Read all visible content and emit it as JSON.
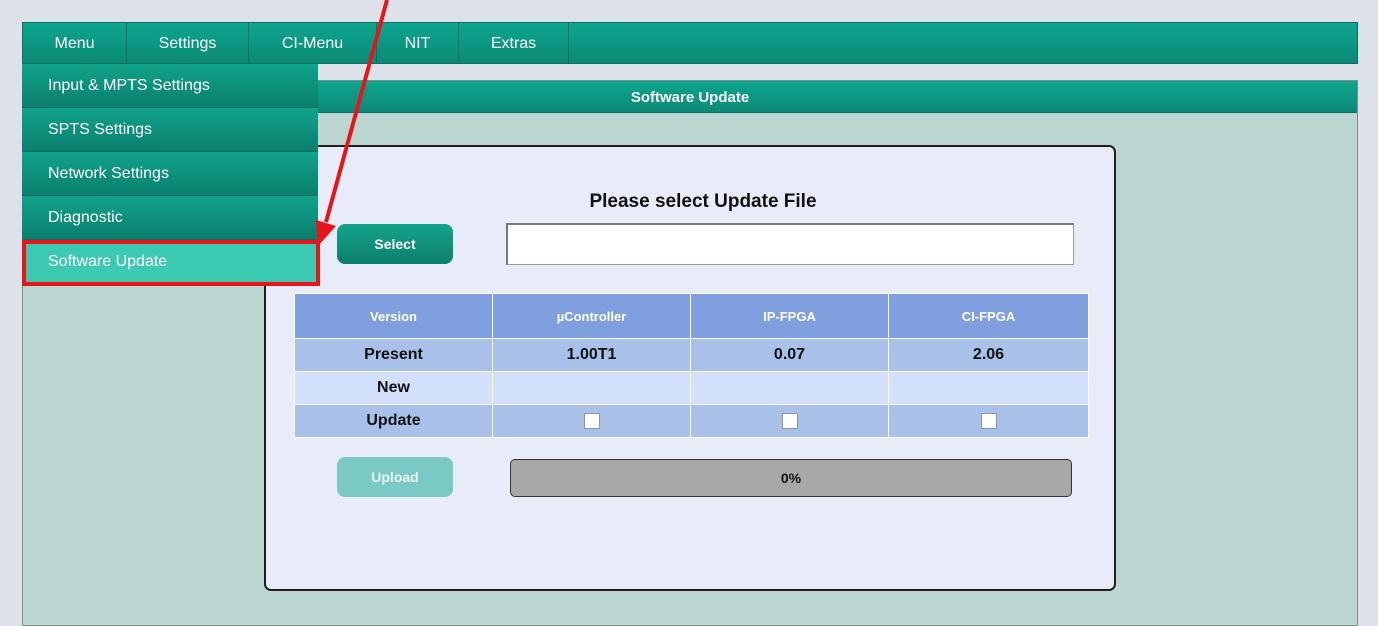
{
  "nav": {
    "items": [
      {
        "label": "Menu"
      },
      {
        "label": "Settings"
      },
      {
        "label": "CI-Menu"
      },
      {
        "label": "NIT"
      },
      {
        "label": "Extras"
      }
    ]
  },
  "dropdown": {
    "items": [
      {
        "label": "Input & MPTS Settings"
      },
      {
        "label": "SPTS Settings"
      },
      {
        "label": "Network Settings"
      },
      {
        "label": "Diagnostic"
      },
      {
        "label": "Software Update"
      }
    ],
    "selected": "Software Update"
  },
  "section": {
    "title": "Software Update"
  },
  "panel": {
    "title": "Please select Update File",
    "select_label": "Select",
    "file_value": "",
    "file_placeholder": "",
    "upload_label": "Upload",
    "progress": {
      "value": 0,
      "label": "0%"
    }
  },
  "version_table": {
    "headers": [
      "Version",
      "µController",
      "IP-FPGA",
      "CI-FPGA"
    ],
    "rows": {
      "present": {
        "label": "Present",
        "values": [
          "1.00T1",
          "0.07",
          "2.06"
        ]
      },
      "new": {
        "label": "New",
        "values": [
          "",
          "",
          ""
        ]
      },
      "update": {
        "label": "Update",
        "checked": [
          false,
          false,
          false
        ]
      }
    }
  },
  "colors": {
    "accent": "#0ea68e",
    "highlight": "#e8141a",
    "active_item": "#3cc9b2"
  }
}
